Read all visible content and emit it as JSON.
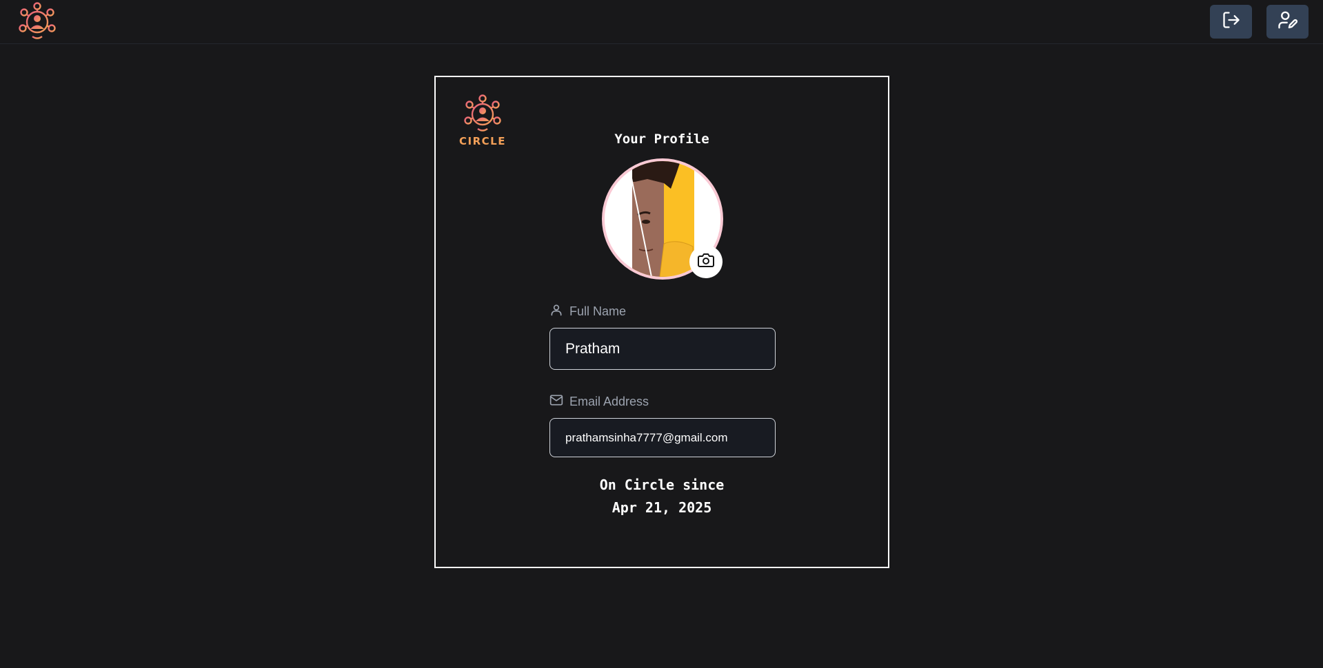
{
  "app": {
    "logo_text": "CIRCLE",
    "brand_color": "#f4a058"
  },
  "topbar": {
    "logo_icon": "circle-network-logo",
    "buttons": [
      {
        "icon": "logout-icon"
      },
      {
        "icon": "edit-profile-icon"
      }
    ],
    "button_bg": "#334155"
  },
  "profile": {
    "title": "Your Profile",
    "avatar_icon": "profile-photo",
    "camera_icon": "camera-icon",
    "full_name_label": "Full Name",
    "full_name_value": "Pratham",
    "email_label": "Email Address",
    "email_value": "prathamsinha7777@gmail.com",
    "since_label": "On Circle since",
    "since_date": "Apr 21, 2025"
  },
  "colors": {
    "background": "#18181a",
    "card_border": "#ffffff",
    "avatar_ring": "#f9c9d4",
    "label_text": "#9ca3af"
  }
}
